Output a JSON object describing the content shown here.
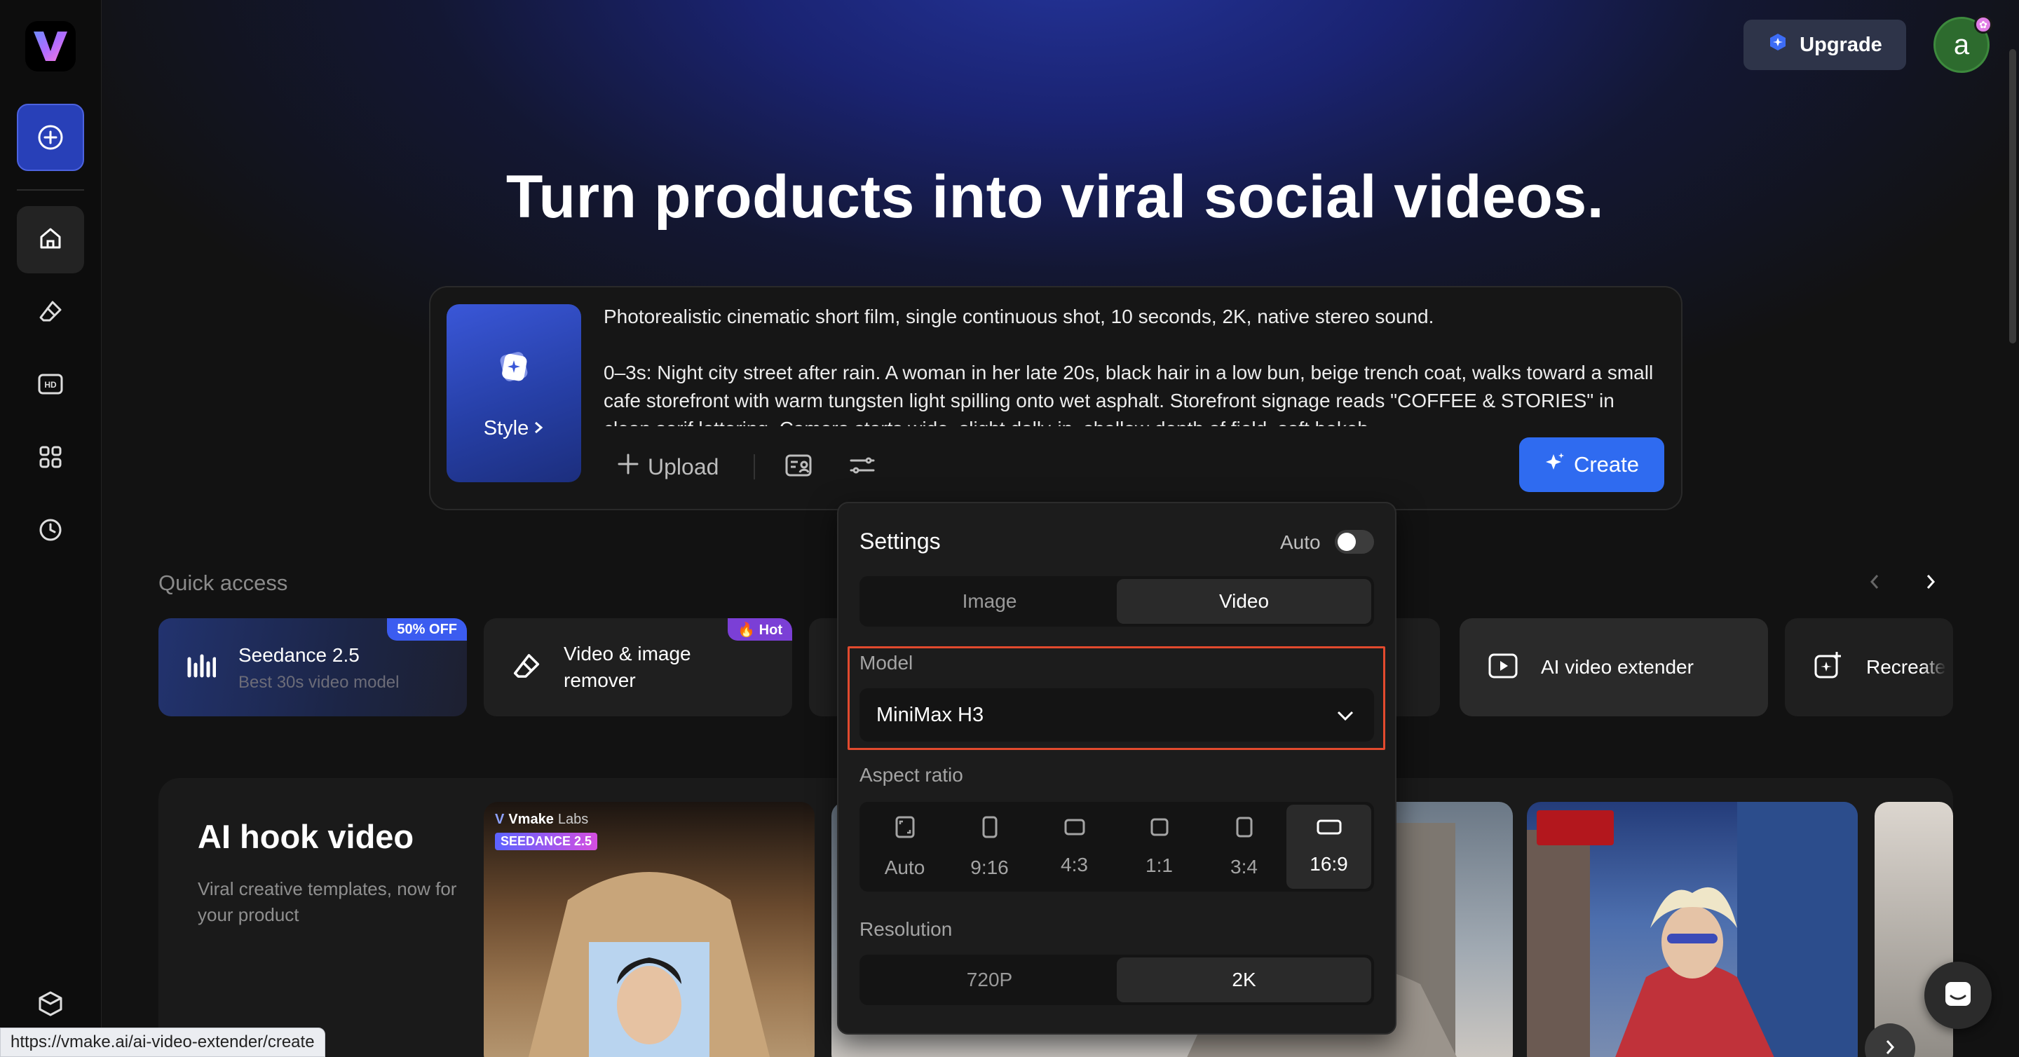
{
  "app": {
    "name": "Vmake"
  },
  "header": {
    "upgrade_label": "Upgrade",
    "avatar_initial": "a"
  },
  "headline": "Turn products into viral social videos.",
  "prompt": {
    "style_label": "Style",
    "text_line1": "Photorealistic cinematic short film, single continuous shot, 10 seconds, 2K, native stereo sound.",
    "text_line2": "0–3s: Night city street after rain. A woman in her late 20s, black hair in a low bun, beige trench coat, walks toward a small cafe storefront with warm tungsten light spilling onto wet asphalt. Storefront signage reads \"COFFEE & STORIES\" in clean serif lettering. Camera starts wide, slight dolly-in, shallow depth of field, soft bokeh",
    "upload_label": "Upload",
    "create_label": "Create"
  },
  "quick_access": {
    "title": "Quick access",
    "cards": [
      {
        "title": "Seedance 2.5",
        "subtitle": "Best 30s video model",
        "badge": "50% OFF"
      },
      {
        "title": "Video & image",
        "title2": "remover",
        "badge": "🔥 Hot"
      },
      {
        "title": "AI video extender"
      },
      {
        "title": "Recreate"
      }
    ]
  },
  "hook": {
    "title": "AI hook video",
    "description": "Viral creative templates, now for your product",
    "thumb_brand": "Vmake",
    "thumb_brand_sub": "Labs",
    "thumb_tag": "SEEDANCE 2.5"
  },
  "settings": {
    "title": "Settings",
    "auto_label": "Auto",
    "tabs": [
      "Image",
      "Video"
    ],
    "active_tab": "Video",
    "model_label": "Model",
    "model_value": "MiniMax H3",
    "aspect_label": "Aspect ratio",
    "ratios": [
      "Auto",
      "9:16",
      "4:3",
      "1:1",
      "3:4",
      "16:9"
    ],
    "active_ratio": "16:9",
    "resolution_label": "Resolution",
    "resolutions": [
      "720P",
      "2K"
    ],
    "active_resolution": "2K"
  },
  "status_url": "https://vmake.ai/ai-video-extender/create",
  "colors": {
    "accent": "#2f6bf0",
    "highlight": "#e24a2e",
    "badge_blue": "#3b5cf0",
    "badge_purple": "#7b3fd6"
  }
}
